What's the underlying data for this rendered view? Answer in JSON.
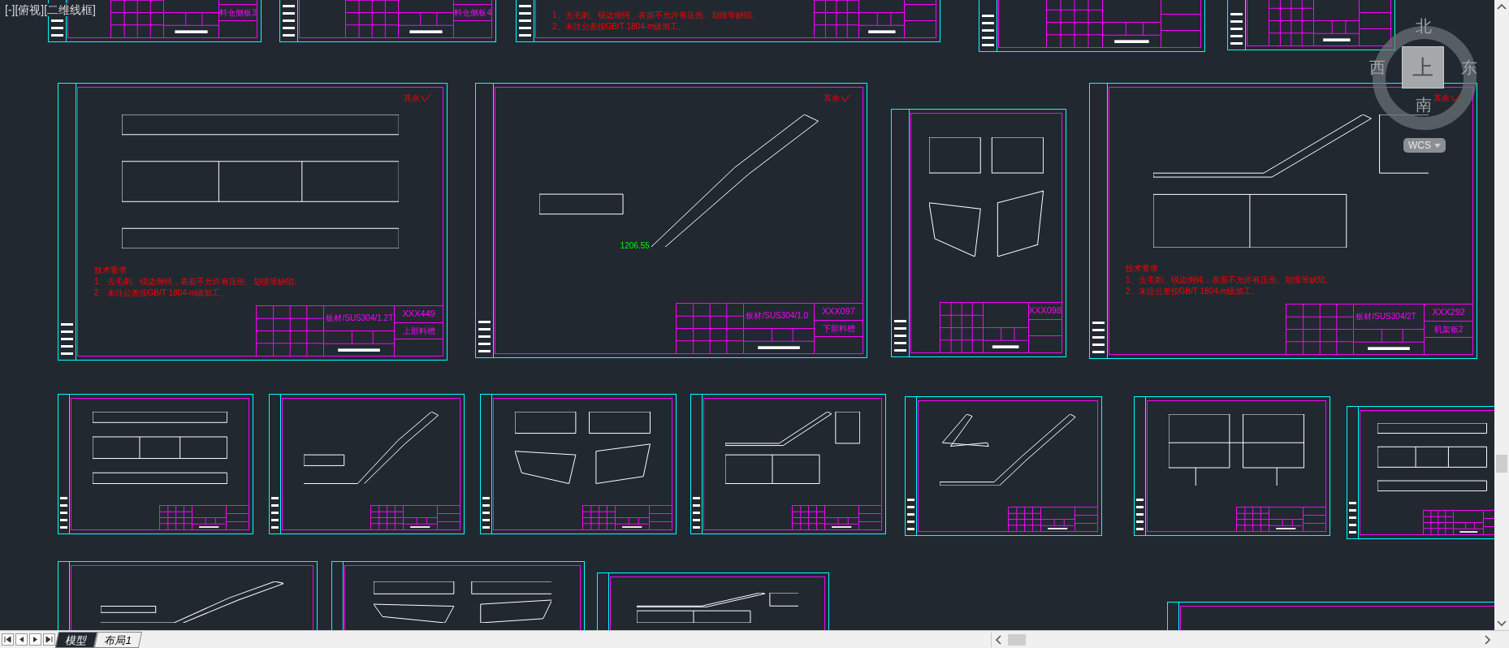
{
  "viewport_label": "[-][俯视][二维线框]",
  "sheets": [
    {
      "name": "料仓侧板3"
    },
    {
      "name": "料仓侧板4"
    },
    {
      "notes": [
        "1、去毛刺、锐边倒钝，表面不允许有压伤、划痕等缺陷。",
        "2、未注公差按GB/T 1804-m级加工。"
      ]
    },
    {
      "roughness": "其余",
      "material": "板材/SUS304/1.2T",
      "code": "XXX449",
      "name": "上部料槽",
      "notes": [
        "技术要求",
        "1、去毛刺、锐边倒钝，表面不允许有压伤、划痕等缺陷。",
        "2、未注公差按GB/T 1804-m级加工。"
      ]
    },
    {
      "roughness": "其余",
      "dimension": "1206.55",
      "material": "板材/SUS304/1.0",
      "code": "XXX097",
      "name": "下部料槽"
    },
    {
      "code": "XXX098"
    },
    {
      "roughness": "其余",
      "material": "板材/SUS304/2T",
      "code": "XXX292",
      "name": "机架板2",
      "notes": [
        "技术要求",
        "1、去毛刺、锐边倒钝，表面不允许有压伤、划痕等缺陷。",
        "2、未注公差按GB/T 1804-m级加工。"
      ]
    }
  ],
  "viewcube": {
    "north": "北",
    "west": "西",
    "east": "东",
    "south": "南",
    "face": "上",
    "ucs_menu": "WCS"
  },
  "layout_tabs": [
    {
      "label": "模型",
      "selected": true
    },
    {
      "label": "布局1",
      "selected": false
    }
  ]
}
